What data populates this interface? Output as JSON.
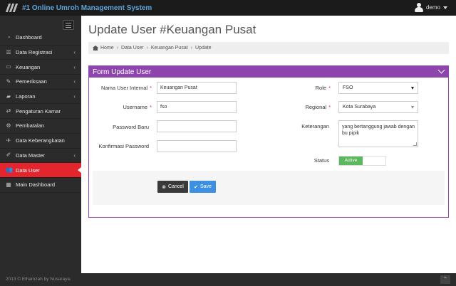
{
  "header": {
    "title": "#1 Online Umroh Management System",
    "user_name": "demo"
  },
  "sidebar": {
    "items": [
      {
        "label": "Dashboard",
        "icon": "dashboard-icon",
        "glyph": "◔",
        "chevron": ""
      },
      {
        "label": "Data Registrasi",
        "icon": "list-icon",
        "glyph": "☰",
        "chevron": "‹"
      },
      {
        "label": "Keuangan",
        "icon": "money-icon",
        "glyph": "▭",
        "chevron": "‹"
      },
      {
        "label": "Pemeriksaan",
        "icon": "check-icon",
        "glyph": "✎",
        "chevron": "‹"
      },
      {
        "label": "Laporan",
        "icon": "folder-icon",
        "glyph": "▰",
        "chevron": "‹"
      },
      {
        "label": "Pengaturan Kamar",
        "icon": "random-icon",
        "glyph": "⇄",
        "chevron": ""
      },
      {
        "label": "Pembatalan",
        "icon": "gear-icon",
        "glyph": "⚙",
        "chevron": ""
      },
      {
        "label": "Data Keberangkatan",
        "icon": "plane-icon",
        "glyph": "✈",
        "chevron": ""
      },
      {
        "label": "Data Master",
        "icon": "edit-icon",
        "glyph": "✐",
        "chevron": "‹"
      },
      {
        "label": "Data User",
        "icon": "users-icon",
        "glyph": "👥",
        "chevron": "",
        "active": true
      },
      {
        "label": "Main Dashboard",
        "icon": "grid-icon",
        "glyph": "▦",
        "chevron": ""
      }
    ]
  },
  "page": {
    "title": "Update User #Keuangan Pusat",
    "breadcrumb": [
      "Home",
      "Data User",
      "Keuangan Pusat",
      "Update"
    ]
  },
  "form": {
    "title": "Form Update User",
    "nama_label": "Nama User Internal",
    "nama_value": "Keuangan Pusat",
    "username_label": "Username",
    "username_value": "fso",
    "password_label": "Password Baru",
    "password_value": "",
    "konfirmasi_label": "Konfirmasi Password",
    "konfirmasi_value": "",
    "role_label": "Role",
    "role_value": "FSO",
    "regional_label": "Regional",
    "regional_value": "Kota Surabaya",
    "keterangan_label": "Keterangan",
    "keterangan_value": "yang bertanggung jawab dengan bu pipik",
    "status_label": "Status",
    "status_value": "Active",
    "required_mark": "*",
    "cancel_label": "Cancel",
    "save_label": "Save"
  },
  "footer": {
    "text": "2013 © Elhamzah by Nusaraya."
  },
  "colors": {
    "accent": "#8e44ad",
    "active_menu": "#e3262e",
    "status_on": "#5cb85c",
    "save": "#3d8fe0"
  }
}
